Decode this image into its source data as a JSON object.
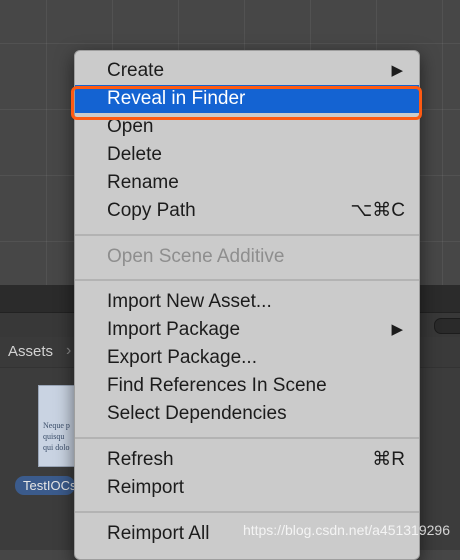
{
  "project_panel": {
    "breadcrumb": "Assets",
    "asset_name": "TestIOCs",
    "thumbnail_text": [
      "Neque p",
      "quisqu",
      "qui dolo"
    ]
  },
  "context_menu": {
    "items": [
      {
        "label": "Create",
        "submenu": true
      },
      {
        "label": "Reveal in Finder",
        "highlighted": true
      },
      {
        "label": "Open"
      },
      {
        "label": "Delete"
      },
      {
        "label": "Rename"
      },
      {
        "label": "Copy Path",
        "shortcut": "⌥⌘C"
      },
      {
        "label": "Open Scene Additive",
        "disabled": true
      },
      {
        "label": "Import New Asset..."
      },
      {
        "label": "Import Package",
        "submenu": true
      },
      {
        "label": "Export Package..."
      },
      {
        "label": "Find References In Scene"
      },
      {
        "label": "Select Dependencies"
      },
      {
        "label": "Refresh",
        "shortcut": "⌘R"
      },
      {
        "label": "Reimport"
      },
      {
        "label": "Reimport All"
      }
    ],
    "submenu_arrow": "▶"
  },
  "watermark": "https://blog.csdn.net/a451319296",
  "colors": {
    "menu_background": "#cbcbcb",
    "highlight": "#1463d2",
    "annotation": "#ff5a12"
  }
}
